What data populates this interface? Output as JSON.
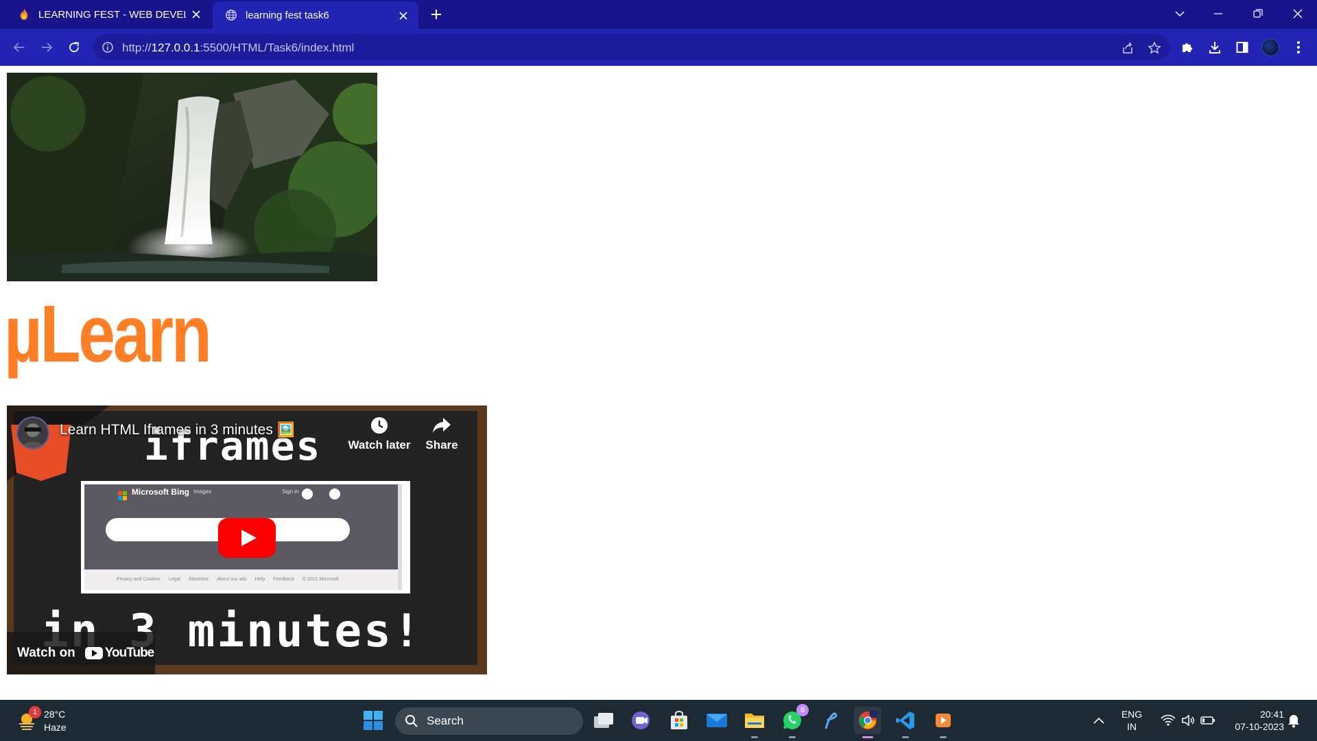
{
  "browser": {
    "tabs": [
      {
        "title": "LEARNING FEST - WEB DEVELOP",
        "active": false
      },
      {
        "title": "learning fest task6",
        "active": true
      }
    ],
    "url": {
      "scheme": "http://",
      "host": "127.0.0.1",
      "rest": ":5500/HTML/Task6/index.html"
    },
    "colors": {
      "tabstrip": "#18148c",
      "toolbar": "#2323b4"
    }
  },
  "page": {
    "logo_text": "µLearn",
    "logo_color": "#ff7f27",
    "video": {
      "title": "Learn HTML Iframes in 3 minutes 🖼️",
      "watch_later": "Watch later",
      "share": "Share",
      "watch_on": "Watch on",
      "youtube": "YouTube",
      "thumb_top_text": "iframes",
      "thumb_bottom_text": "in 3 minutes!",
      "bing_label": "Microsoft Bing",
      "bing_images": "Images",
      "bing_sign_in": "Sign in",
      "bing_footer": [
        "Privacy and Cookies",
        "Legal",
        "Advertise",
        "About our ads",
        "Help",
        "Feedback",
        "© 2021 Microsoft"
      ]
    }
  },
  "taskbar": {
    "weather": {
      "temp": "28°C",
      "condition": "Haze",
      "badge": "1"
    },
    "search_label": "Search",
    "whatsapp_badge": "8",
    "lang": {
      "line1": "ENG",
      "line2": "IN"
    },
    "clock": {
      "time": "20:41",
      "date": "07-10-2023"
    }
  }
}
